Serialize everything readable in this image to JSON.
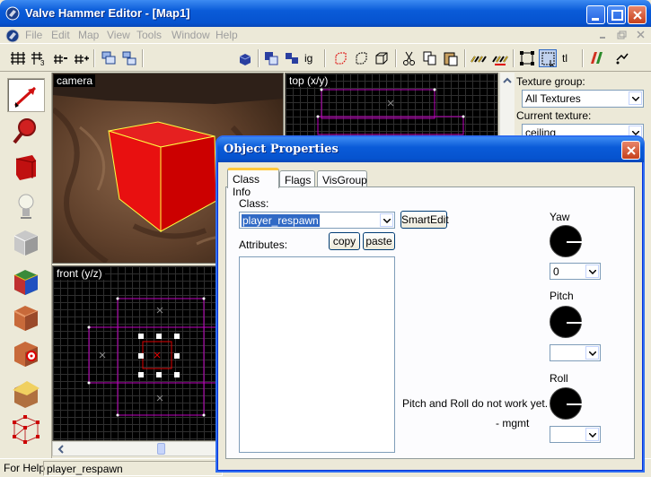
{
  "window": {
    "title": "Valve Hammer Editor - [Map1]"
  },
  "menu": {
    "items": [
      "File",
      "Edit",
      "Map",
      "View",
      "Tools",
      "Window",
      "Help"
    ]
  },
  "toolbar": {
    "text_button": "tl",
    "ig_button": "ig"
  },
  "viewports": {
    "camera_label": "camera",
    "top_label": "top (x/y)",
    "front_label": "front (y/z)"
  },
  "texture_panel": {
    "group_label": "Texture group:",
    "group_value": "All Textures",
    "current_label": "Current texture:",
    "current_value": "ceiling"
  },
  "statusbar": {
    "help": "For Help",
    "field": "player_respawn"
  },
  "dialog": {
    "title": "Object Properties",
    "tabs": [
      "Class Info",
      "Flags",
      "VisGroup"
    ],
    "class_label": "Class:",
    "class_value": "player_respawn",
    "smartedit": "SmartEdit",
    "attributes_label": "Attributes:",
    "copy": "copy",
    "paste": "paste",
    "yaw_label": "Yaw",
    "yaw_value": "0",
    "pitch_label": "Pitch",
    "roll_label": "Roll",
    "note": "Pitch and Roll do not work yet. ->",
    "signature": "- mgmt"
  },
  "colors": {
    "xp_blue": "#0a5bd8",
    "brush_red": "#e00000",
    "selection_magenta": "#c000c0"
  }
}
